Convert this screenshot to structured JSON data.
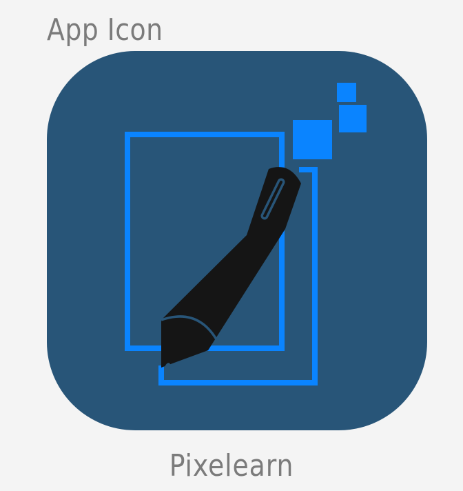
{
  "header": {
    "title": "App Icon"
  },
  "app": {
    "name": "Pixelearn"
  },
  "icon": {
    "glyph": "pen-on-canvas-icon",
    "colors": {
      "tile_background": "#285578",
      "accent_blue": "#0a84ff",
      "pen": "#151515",
      "page_background": "#f4f4f4",
      "text": "#7b7b7b"
    }
  }
}
